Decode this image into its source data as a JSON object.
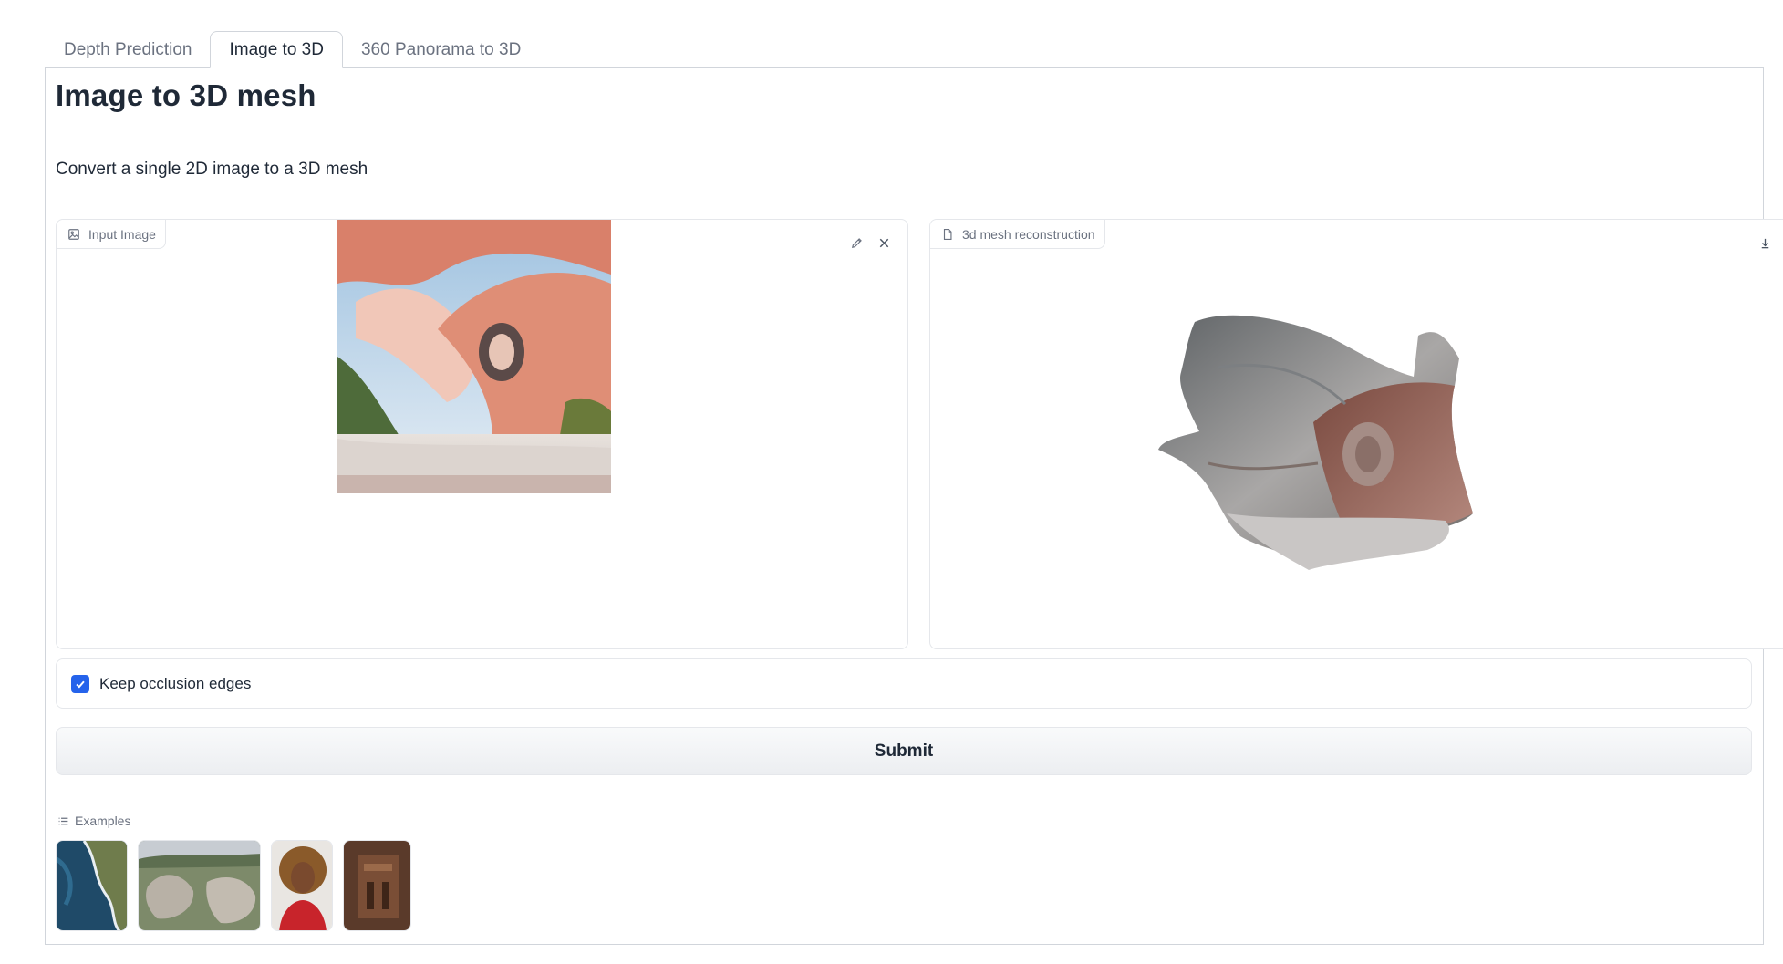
{
  "tabs": [
    {
      "label": "Depth Prediction",
      "active": false
    },
    {
      "label": "Image to 3D",
      "active": true
    },
    {
      "label": "360 Panorama to 3D",
      "active": false
    }
  ],
  "page": {
    "title": "Image to 3D mesh",
    "description": "Convert a single 2D image to a 3D mesh"
  },
  "input_image": {
    "label": "Input Image",
    "icons": [
      "image-icon",
      "edit-icon",
      "close-icon"
    ]
  },
  "output_model": {
    "label": "3d mesh reconstruction",
    "icons": [
      "file-icon",
      "download-icon"
    ]
  },
  "options": {
    "keep_occlusion_edges_label": "Keep occlusion edges",
    "keep_occlusion_edges_checked": true
  },
  "actions": {
    "submit_label": "Submit"
  },
  "examples": {
    "label": "Examples",
    "items": [
      "coastal-aerial-thumbnail",
      "rock-formations-thumbnail",
      "portrait-thumbnail",
      "carved-facade-thumbnail"
    ]
  },
  "colors": {
    "accent": "#2563eb",
    "border": "#e5e7eb",
    "text": "#1f2937",
    "muted": "#6b7280"
  }
}
